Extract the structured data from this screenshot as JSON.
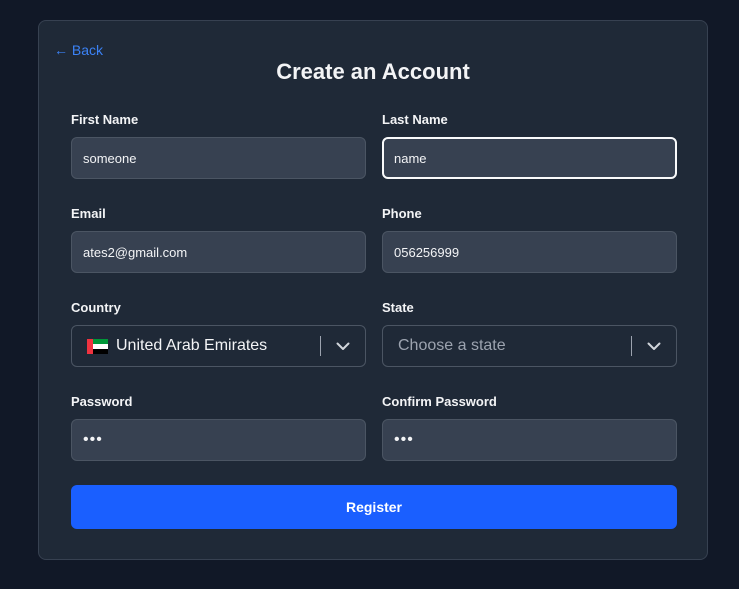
{
  "form": {
    "back_label": "← Back",
    "title": "Create an Account",
    "first_name": {
      "label": "First Name",
      "value": "someone"
    },
    "last_name": {
      "label": "Last Name",
      "value": "name"
    },
    "email": {
      "label": "Email",
      "value": "ates2@gmail.com"
    },
    "phone": {
      "label": "Phone",
      "value": "056256999"
    },
    "country": {
      "label": "Country",
      "value": "United Arab Emirates",
      "flag_icon": "uae-flag-icon"
    },
    "state": {
      "label": "State",
      "placeholder": "Choose a state"
    },
    "password": {
      "label": "Password",
      "value": "•••"
    },
    "confirm_password": {
      "label": "Confirm Password",
      "value": "•••"
    },
    "register_label": "Register"
  },
  "colors": {
    "page_background": "#111827",
    "card_background": "#1f2937",
    "input_background": "#374151",
    "link_accent": "#3b82f6",
    "button_primary": "#1a5fff",
    "text_primary": "#f3f4f6",
    "placeholder": "#9ca3af"
  }
}
